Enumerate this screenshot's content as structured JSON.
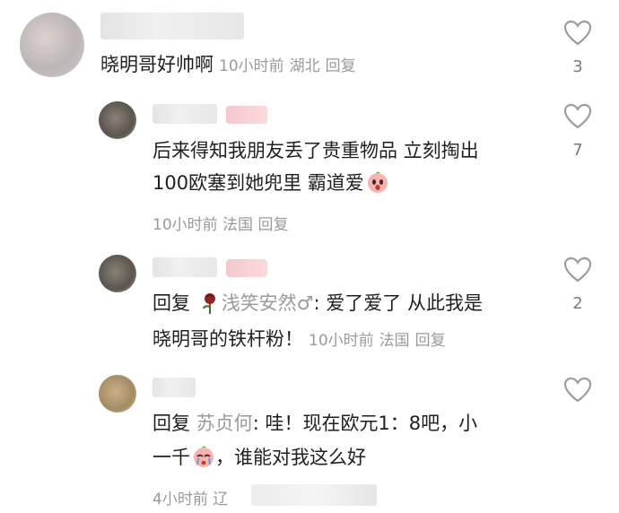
{
  "comments": [
    {
      "text": "晓明哥好帅啊",
      "time": "10小时前",
      "location": "湖北",
      "reply_label": "回复",
      "likes": "3"
    },
    {
      "line1": "后来得知我朋友丢了贵重物品 立刻掏出",
      "line2": "100欧塞到她兜里 霸道爱",
      "time": "10小时前",
      "location": "法国",
      "reply_label": "回复",
      "likes": "7"
    },
    {
      "prefix": "回复",
      "mention": "浅笑安然♂",
      "line1_rest": ": 爱了爱了 从此我是",
      "line2": "晓明哥的铁杆粉！",
      "time": "10小时前",
      "location": "法国",
      "reply_label": "回复",
      "likes": "2"
    },
    {
      "prefix": "回复",
      "mention": "苏贞何",
      "line1_rest": ": 哇！现在欧元1：8吧，小",
      "line2_a": "一千",
      "line2_b": "，谁能对我这么好",
      "time": "4小时前",
      "location": "辽"
    }
  ]
}
